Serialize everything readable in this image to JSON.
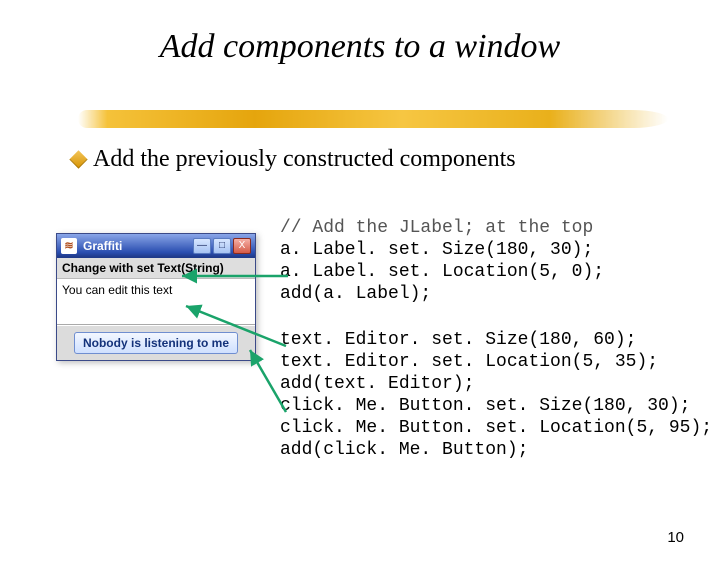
{
  "slide": {
    "title": "Add components to a window",
    "bullet": "Add the previously constructed components",
    "page_number": "10"
  },
  "jwin": {
    "title": "Graffiti",
    "min": "—",
    "max": "□",
    "close": "X",
    "label_text": "Change with set Text(String)",
    "editor_text": "You can edit this text",
    "button_text": "Nobody is listening to me",
    "java_icon": "≋"
  },
  "code": {
    "block1": [
      "// Add the JLabel; at the top",
      "a. Label. set. Size(180, 30);",
      "a. Label. set. Location(5, 0);",
      "add(a. Label);"
    ],
    "block2": [
      "text. Editor. set. Size(180, 60);",
      "text. Editor. set. Location(5, 35);",
      "add(text. Editor);",
      "click. Me. Button. set. Size(180, 30);",
      "click. Me. Button. set. Location(5, 95);",
      "add(click. Me. Button);"
    ]
  }
}
